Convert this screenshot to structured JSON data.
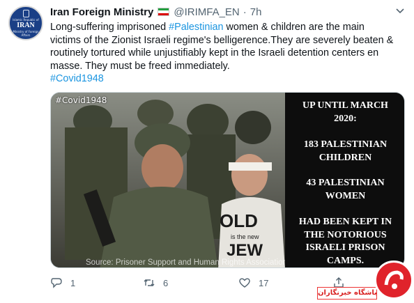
{
  "account": {
    "name": "Iran Foreign Ministry",
    "handle": "@IRIMFA_EN",
    "separator": "·",
    "time": "7h",
    "avatar": {
      "line1": "Islamic Republic of",
      "line2": "IRAN",
      "line3": "Ministry of Foreign Affairs"
    }
  },
  "tweet": {
    "line1_pre": "Long-suffering imprisoned ",
    "line1_link": "#Palestinian",
    "line1_post": " women & children are the main",
    "line2": "victims of the Zionist Israeli regime's belligerence.They are severely beaten &",
    "line3": "routinely tortured while unjustifiably kept in the Israeli detention centers en",
    "line4": "masse. They must be freed immediately.",
    "hashtag": "#Covid1948"
  },
  "media": {
    "hashtag_overlay": "#Covid1948",
    "source": "Source: Prisoner Support and Human Rights Association",
    "shirt_lines": [
      "OLD",
      "is the new",
      "JEW"
    ],
    "panel": {
      "b1": [
        "UP UNTIL MARCH",
        "2020:"
      ],
      "b2": [
        "183 PALESTINIAN",
        "CHILDREN"
      ],
      "b3": [
        "43 PALESTINIAN",
        "WOMEN"
      ],
      "b4": [
        "HAD BEEN KEPT IN",
        "THE NOTORIOUS",
        "ISRAELI PRISON",
        "CAMPS."
      ]
    }
  },
  "actions": {
    "reply_count": "1",
    "retweet_count": "6",
    "like_count": "17"
  },
  "watermark": {
    "text": "باشگاه خبرنگاران"
  },
  "colors": {
    "link": "#1b95e0",
    "secondary_text": "#536471",
    "panel_bg": "#0d0d0d",
    "watermark_red": "#e0232b",
    "flag": [
      "#239f40",
      "#ffffff",
      "#da0000"
    ]
  },
  "icons": [
    "chevron-down-icon",
    "reply-icon",
    "retweet-icon",
    "like-icon",
    "share-icon",
    "flag-icon"
  ]
}
